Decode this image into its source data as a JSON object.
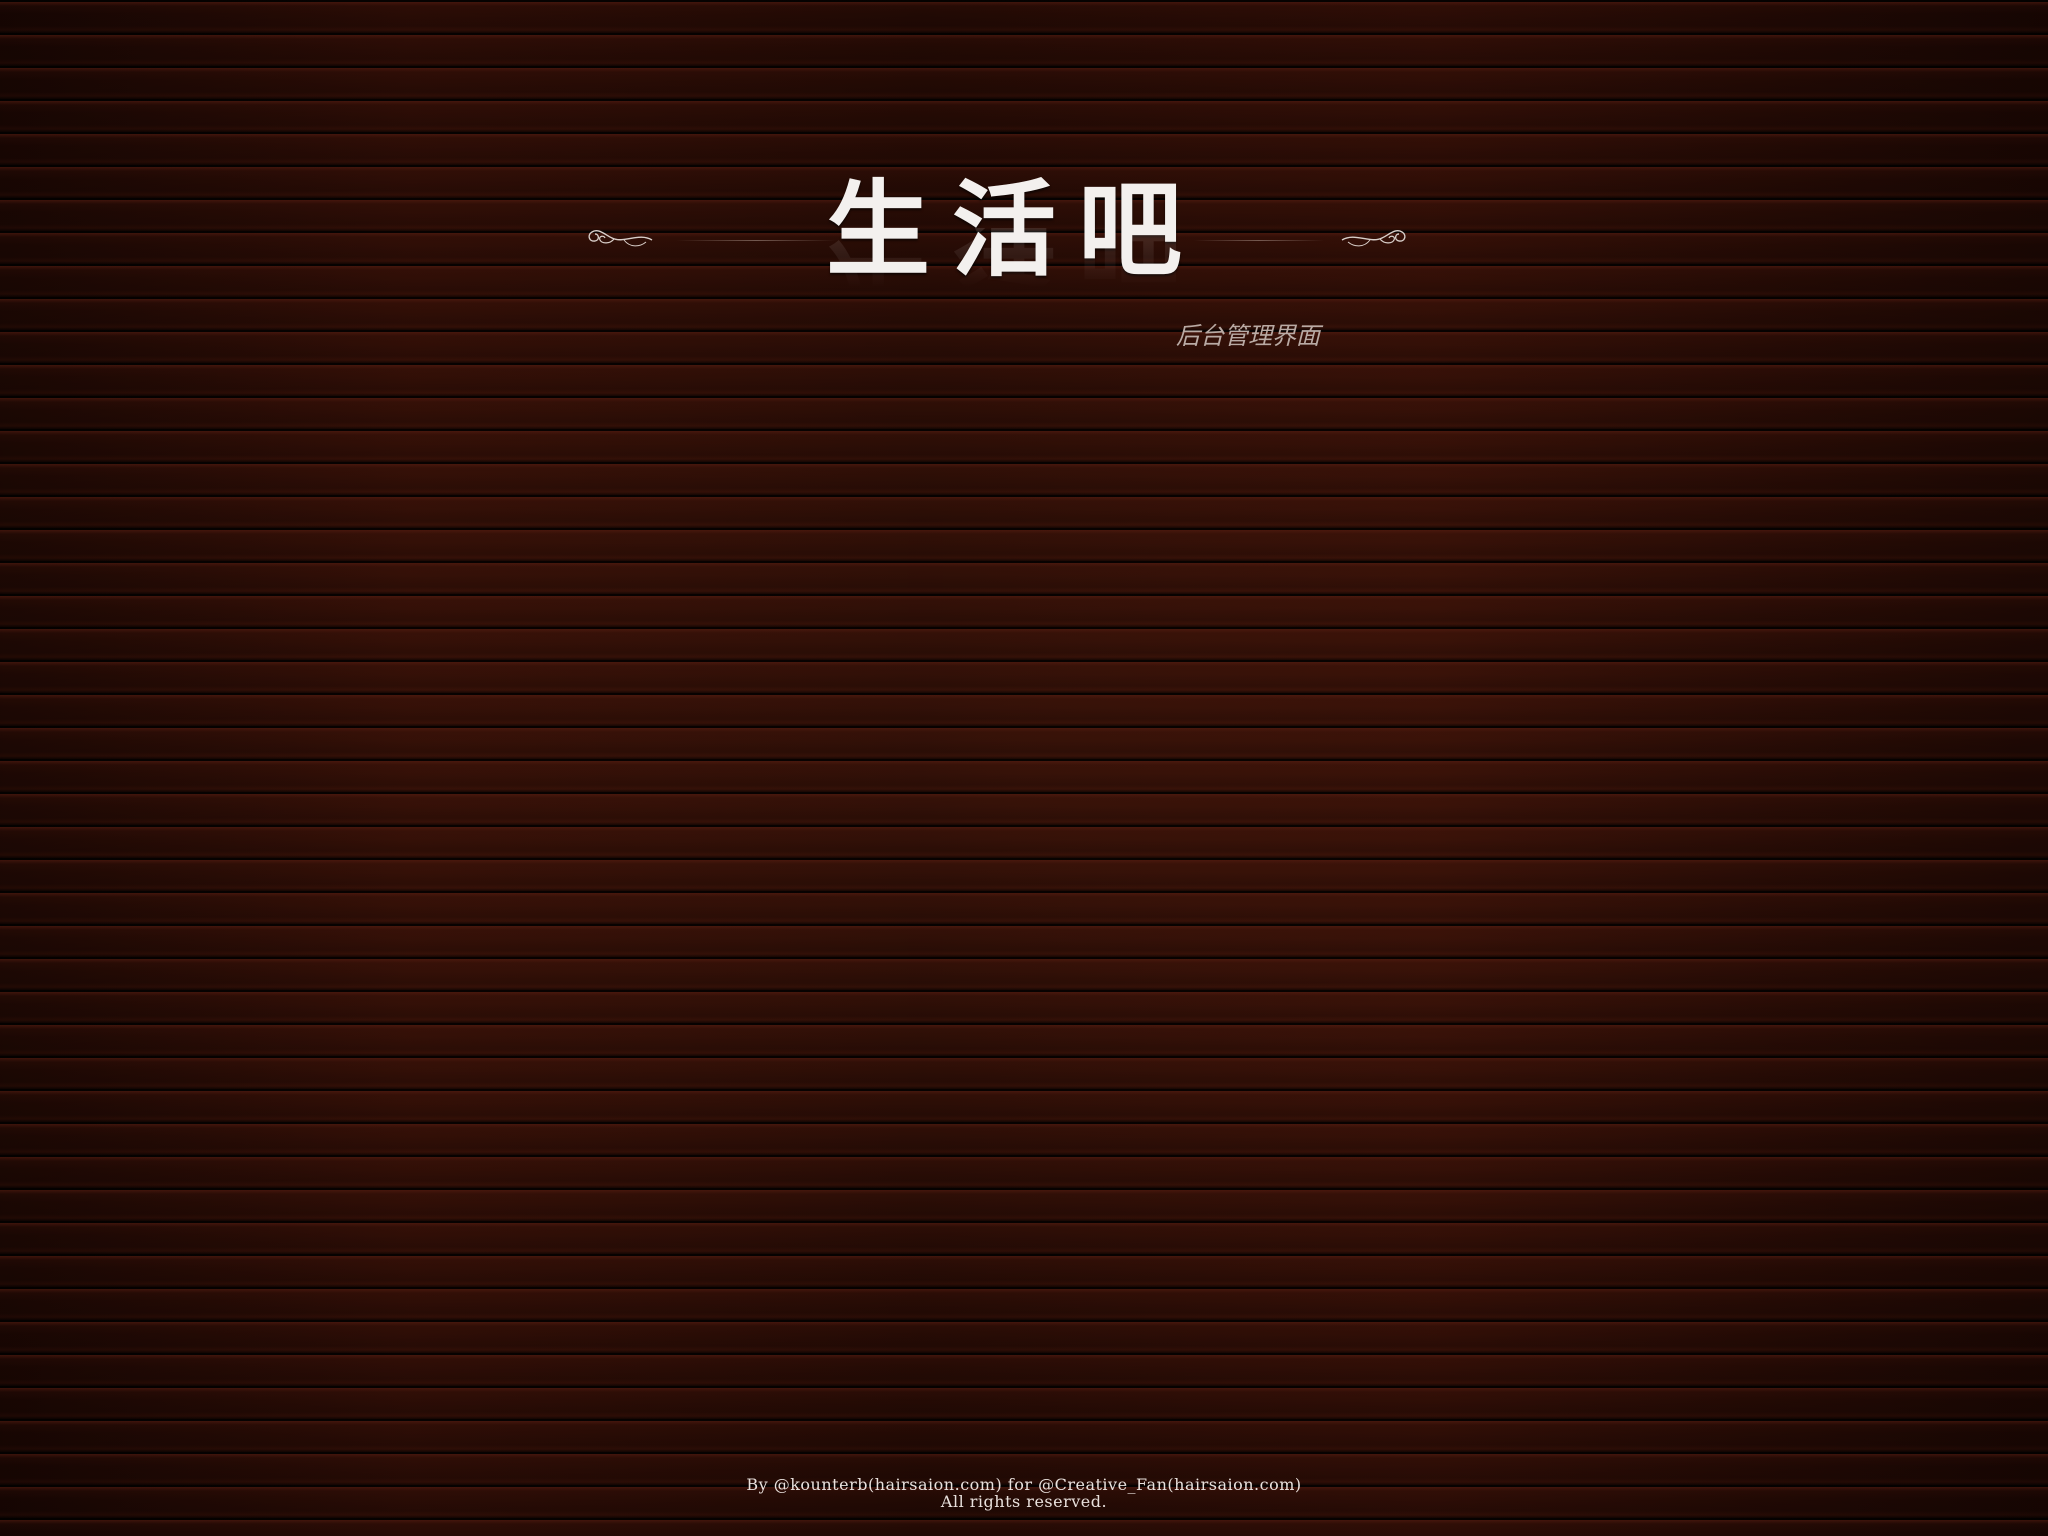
{
  "header": {
    "title": "生活吧",
    "subtitle": "后台管理界面",
    "left_ornament_icon": "flourish-icon",
    "right_ornament_icon": "flourish-icon"
  },
  "footer": {
    "line1": "By @kounterb(hairsaion.com) for @Creative_Fan(hairsaion.com)",
    "line2": "All rights reserved."
  },
  "colors": {
    "background": "#2a0e07",
    "title": "#f3f0ee",
    "subtitle": "#b9aaa4",
    "footer_text": "#e9e1dd"
  }
}
